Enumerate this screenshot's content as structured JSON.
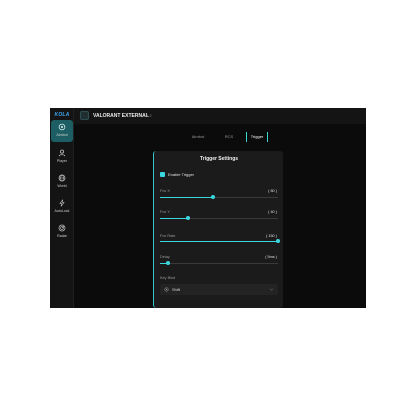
{
  "brand": {
    "logo_text": "KOLA",
    "accent": "#3ad7e0"
  },
  "app": {
    "title": "VALORANT EXTERNAL",
    "version": "2.2"
  },
  "sidebar": {
    "items": [
      {
        "label": "Aimbot",
        "icon": "crosshair-icon",
        "active": true
      },
      {
        "label": "Player",
        "icon": "user-icon",
        "active": false
      },
      {
        "label": "World",
        "icon": "globe-icon",
        "active": false
      },
      {
        "label": "AutoLock",
        "icon": "lightning-icon",
        "active": false
      },
      {
        "label": "Radar",
        "icon": "radar-icon",
        "active": false
      }
    ]
  },
  "tabs": [
    {
      "label": "Aimbot",
      "active": false
    },
    {
      "label": "RCS",
      "active": false
    },
    {
      "label": "Trigger",
      "active": true
    }
  ],
  "panel": {
    "title": "Trigger Settings",
    "enable_trigger": {
      "label": "Enable Trigger",
      "checked": true
    },
    "sliders": [
      {
        "label": "Fov X",
        "value_text": "( 80 )",
        "fraction": 0.45
      },
      {
        "label": "Fov Y",
        "value_text": "( 40 )",
        "fraction": 0.24
      },
      {
        "label": "Fov Rate",
        "value_text": "( 150 )",
        "fraction": 1.0
      },
      {
        "label": "Delay",
        "value_text": "( 5ms )",
        "fraction": 0.07
      }
    ],
    "key_bind": {
      "label": "Key Bind",
      "value": "Shift"
    }
  }
}
